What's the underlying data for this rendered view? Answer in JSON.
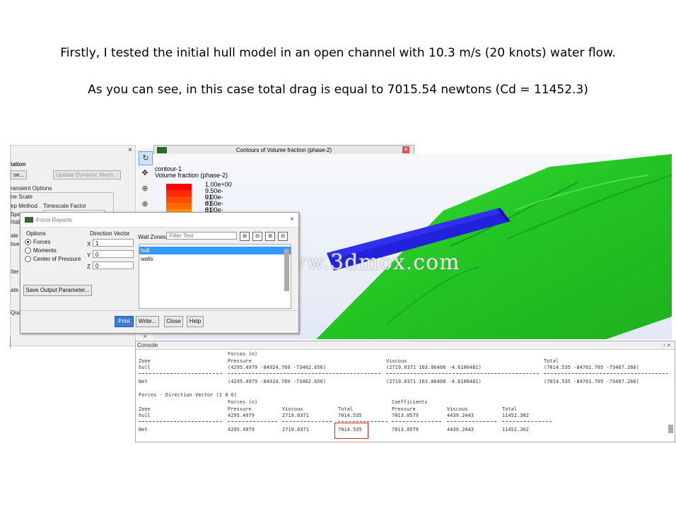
{
  "slide": {
    "line1": "Firstly, I tested the initial hull model in an open channel with 10.3 m/s (20 knots) water flow.",
    "line2": "As you can see, in this case total drag is equal to 7015.54 newtons (Cd = 11452.3)"
  },
  "bg_panel": {
    "heading": "iation",
    "btn1": "se...",
    "update_btn": "Update Dynamic Mesh...",
    "transient": "ransient Options",
    "scale": "ne Scale",
    "step_method": "ep Method",
    "timescale": "Timescale Factor",
    "spe": "Spe",
    "mati": "mati",
    "ale": "ale",
    "tive": "tive",
    "iter": "Iter",
    "ate": "ate",
    "qua": "Qua",
    "close": "×"
  },
  "graphics": {
    "window_title": "Contours of Volume fraction (phase-2)",
    "contour_name": "contour-1",
    "contour_field": "Volume fraction (phase-2)",
    "legend": [
      {
        "label": "1.00e+00",
        "color": "#ff0000"
      },
      {
        "label": "9.50e-01",
        "color": "#ff2a00"
      },
      {
        "label": "9.00e-01",
        "color": "#ff4a00"
      },
      {
        "label": "8.50e-01",
        "color": "#ff6a00"
      },
      {
        "label": "8.00e-01",
        "color": "#ff8a00"
      }
    ],
    "watermark": "莫西网www.3dmox.com",
    "colors": {
      "water": "#2ed12e",
      "hull": "#2020e0",
      "sky": "#eef2fb"
    }
  },
  "toolbar": {
    "icons": [
      "rotate-icon",
      "pan-icon",
      "zoom-icon",
      "zoom-box-icon"
    ],
    "expand": "»"
  },
  "dialog": {
    "title": "Force Reports",
    "options_label": "Options",
    "opt_forces": "Forces",
    "opt_moments": "Moments",
    "opt_center": "Center of Pressure",
    "direction_label": "Direction Vector",
    "x_label": "X",
    "y_label": "Y",
    "z_label": "Z",
    "x_val": "1",
    "y_val": "0",
    "z_val": "0",
    "wall_zones_label": "Wall Zones",
    "filter_placeholder": "Filter Text",
    "zones": [
      "hull",
      "walls"
    ],
    "save_btn": "Save Output Parameter...",
    "print_btn": "Print",
    "write_btn": "Write...",
    "close_btn": "Close",
    "help_btn": "Help",
    "close_x": "×"
  },
  "console": {
    "title": "Console",
    "win_icons": "▫ ×",
    "rows": [
      {
        "cols": [
          "",
          "Forces (n)",
          "",
          "",
          "",
          "",
          ""
        ],
        "y": 15
      },
      {
        "cols": [
          "Zone",
          "Pressure",
          "",
          "",
          "Viscous",
          "",
          "Total"
        ],
        "y": 24
      },
      {
        "cols": [
          "hull",
          "(4295.4979 -84924.769 -73462.656)",
          "",
          "",
          "(2719.0371 163.06408 -4.6106481)",
          "",
          "(7014.535 -84761.705 -73467.266)"
        ],
        "y": 33
      },
      {
        "cols": [
          "Net",
          "(4295.4979 -84924.769 -73462.656)",
          "",
          "",
          "(2719.0371 163.06408 -4.6106481)",
          "",
          "(7014.535 -84761.705 -73467.266)"
        ],
        "y": 53
      }
    ],
    "dir_line": "Forces - Direction Vector (1 0 0)",
    "sub_hdr1": [
      "Forces (n)",
      "Coefficients"
    ],
    "sub_hdr2": [
      "Zone",
      "Pressure",
      "Viscous",
      "Total",
      "Pressure",
      "Viscous",
      "Total"
    ],
    "hull_row": [
      "hull",
      "4295.4979",
      "2719.0371",
      "7014.535",
      "7013.0579",
      "4439.2443",
      "11452.302"
    ],
    "net_row": [
      "Net",
      "4295.4979",
      "2719.0371",
      "7014.535",
      "7013.0579",
      "4439.2443",
      "11452.302"
    ]
  }
}
